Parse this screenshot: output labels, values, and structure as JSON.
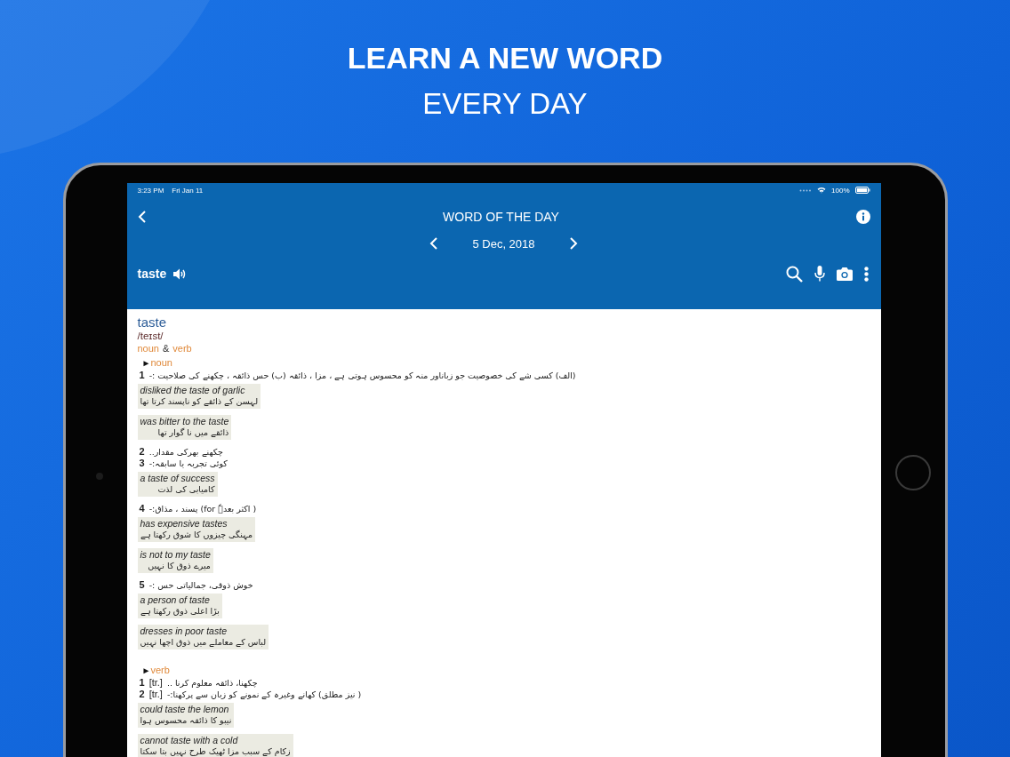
{
  "headline": {
    "title": "LEARN A NEW WORD",
    "subtitle": "EVERY DAY"
  },
  "status_bar": {
    "time": "3:23 PM",
    "date": "Fri Jan 11",
    "battery": "100%"
  },
  "header": {
    "title": "WORD OF THE DAY",
    "date": "5 Dec, 2018",
    "word": "taste"
  },
  "entry": {
    "word": "taste",
    "pronunciation": "/teɪst/",
    "pos_line": {
      "first": "noun",
      "conjunction": "&",
      "second": "verb"
    },
    "sections": [
      {
        "marker": "►",
        "label": "noun",
        "senses": [
          {
            "number": "1",
            "text": "(الف) کسی شے کی خصوصیت جو زباناور منہ کو محسوس ہوتی ہے ، مزا ، ذائقہ (ب) حس ذائقہ ، چکھنے کی صلاحیت :-",
            "examples": [
              {
                "en": "disliked the taste of garlic",
                "ur": "لہسن کے ذائقے کو ناپسند کرتا تھا"
              },
              {
                "en": "was bitter to the taste",
                "ur": "ذائقے میں نا گوار تھا"
              }
            ]
          },
          {
            "number": "2",
            "text": "چکھنے بھرکی مقدار.."
          },
          {
            "number": "3",
            "text": "کوئی تجربہ یا سابقہ:-",
            "examples": [
              {
                "en": "a taste of success",
                "ur": "کامیابی کی لذت"
              }
            ]
          },
          {
            "number": "4",
            "text": "( اکثر بعدہٗ for) پسند ، مذاق:-",
            "examples": [
              {
                "en": "has expensive tastes",
                "ur": "مہنگی چیزوں کا شوق رکھتا ہے"
              },
              {
                "en": "is not to my taste",
                "ur": "میرے ذوق کا نہیں"
              }
            ]
          },
          {
            "number": "5",
            "text": "خوش ذوقی، جمالیاتی حس :-",
            "examples": [
              {
                "en": "a person of taste",
                "ur": "بڑا اعلی ذوق رکھتا ہے"
              },
              {
                "en": "dresses in poor taste",
                "ur": "لباس کے معاملے میں ذوق اچھا نہیں"
              }
            ]
          }
        ]
      },
      {
        "marker": "►",
        "label": "verb",
        "senses": [
          {
            "number": "1",
            "tag": "[tr.]",
            "text": "چکھنا، ذائقہ معلوم کرنا .."
          },
          {
            "number": "2",
            "tag": "[tr.]",
            "text": "( نیز مطلق) کھانے وغیرہ کے نمونے کو زبان سے پرکھنا:-",
            "examples": [
              {
                "en": "could taste the lemon",
                "ur": "نیبو کا ذائقہ محسوس ہوا"
              },
              {
                "en": "cannot taste with a cold",
                "ur": "زکام کے سبب مزا ٹھیک طرح نہیں بتا سکتا"
              }
            ]
          }
        ]
      }
    ]
  }
}
